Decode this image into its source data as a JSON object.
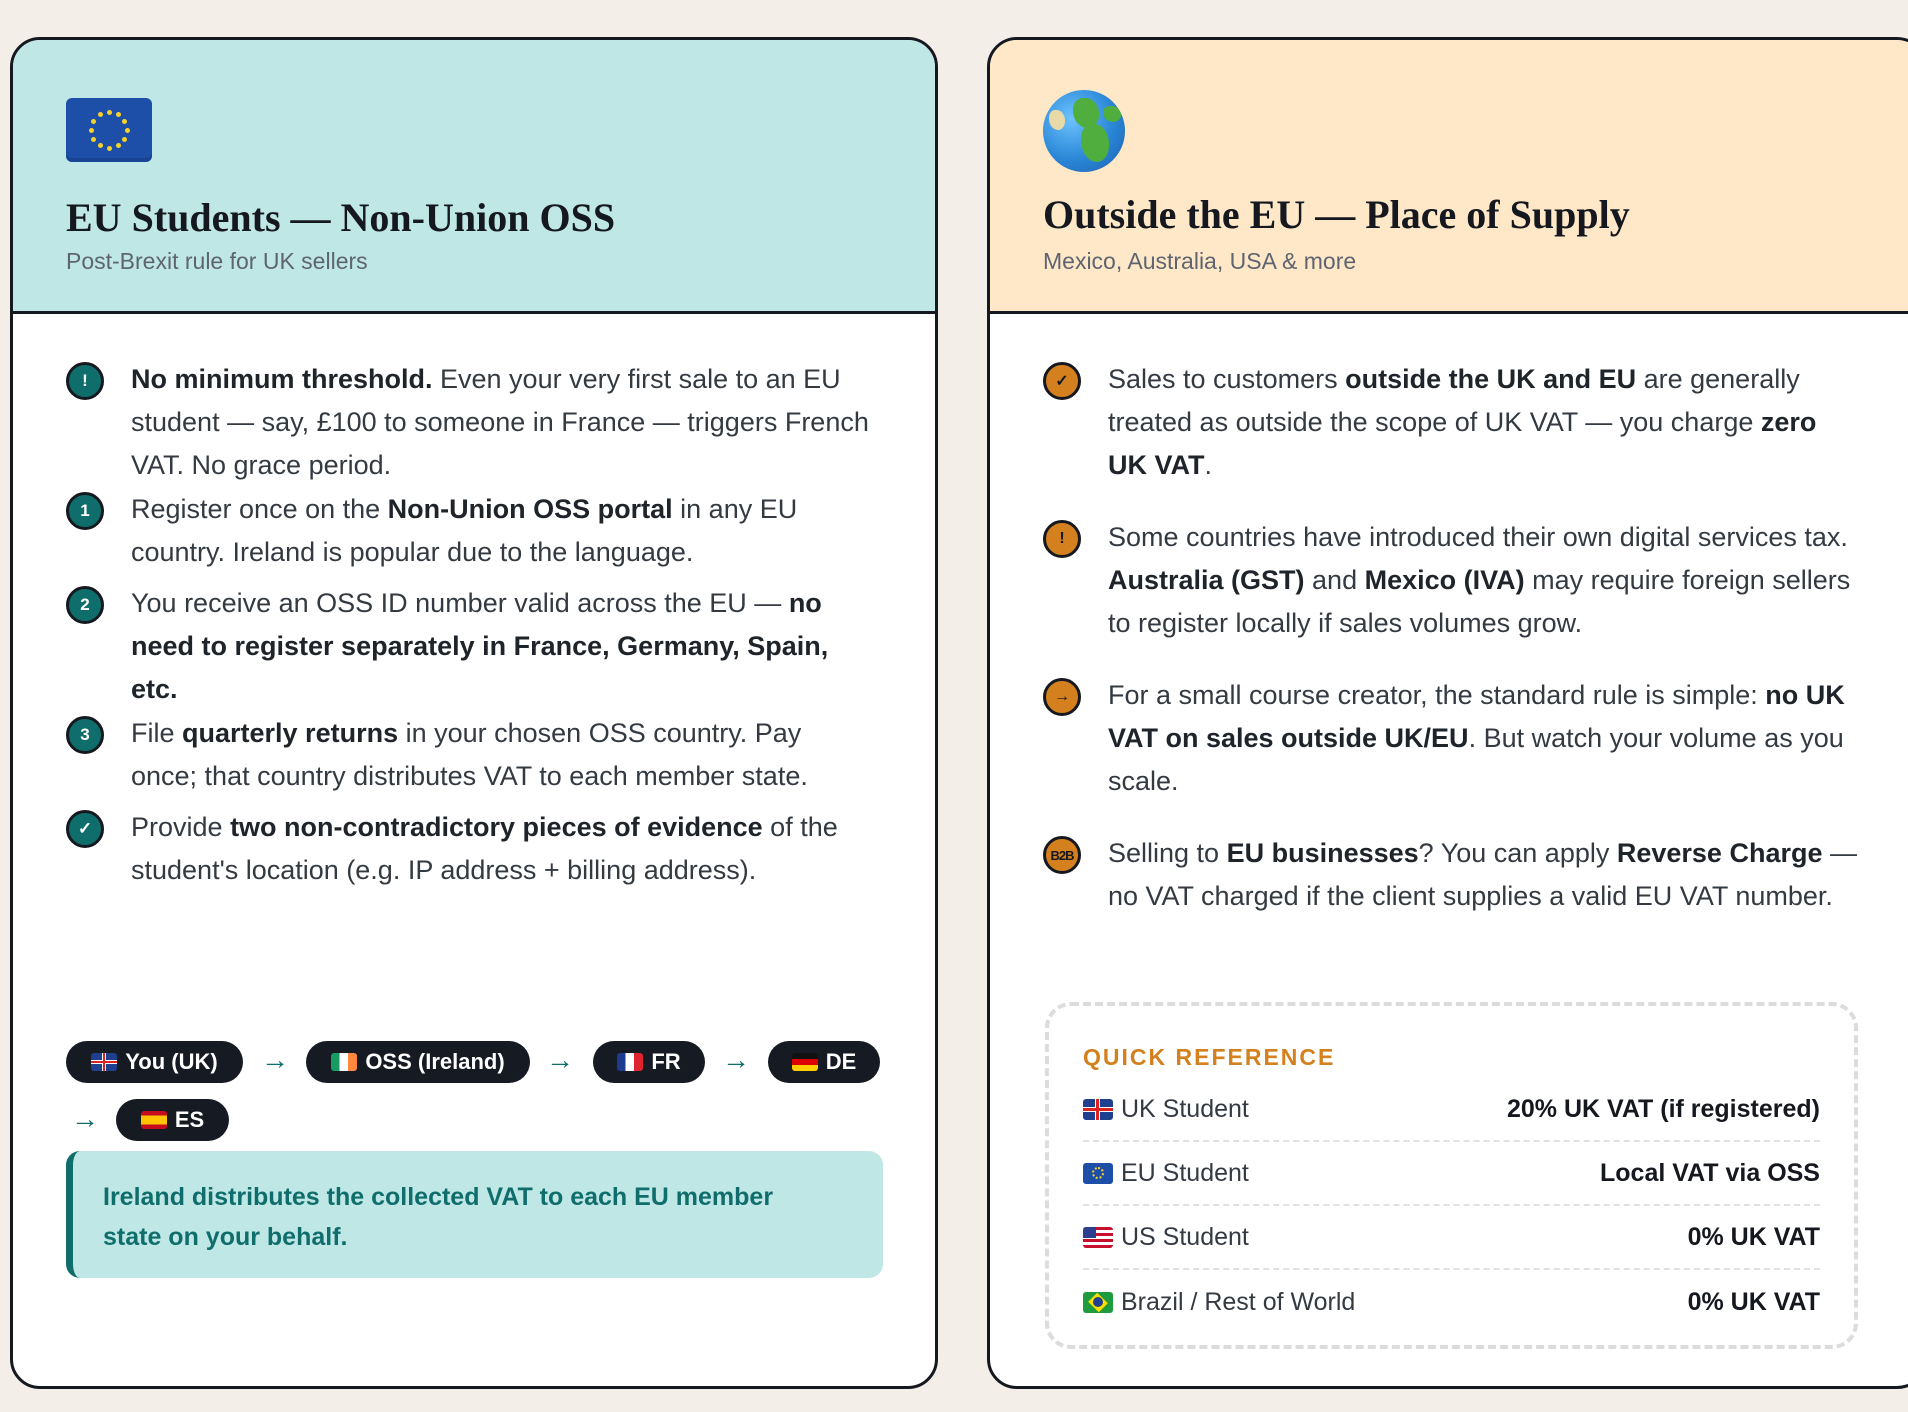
{
  "eu_card": {
    "title": "EU Students — Non-Union OSS",
    "subtitle": "Post-Brexit rule for UK sellers",
    "flag_icon": "eu-flag-icon",
    "header_color": "#bfe7e5",
    "accent_color": "#0f6e6b",
    "items": [
      {
        "badge": "!",
        "parts": [
          {
            "b": "No minimum threshold."
          },
          {
            "t": " Even your very first sale to an EU student — say, £100 to someone in France — triggers French VAT. No grace period."
          }
        ]
      },
      {
        "badge": "1",
        "parts": [
          {
            "t": "Register once on the "
          },
          {
            "b": "Non-Union OSS portal"
          },
          {
            "t": " in any EU country. Ireland is popular due to the language."
          }
        ]
      },
      {
        "badge": "2",
        "parts": [
          {
            "t": "You receive an OSS ID number valid across the EU — "
          },
          {
            "b": "no need to register separately in France, Germany, Spain, etc."
          }
        ]
      },
      {
        "badge": "3",
        "parts": [
          {
            "t": "File "
          },
          {
            "b": "quarterly returns"
          },
          {
            "t": " in your chosen OSS country. Pay once; that country distributes VAT to each member state."
          }
        ]
      },
      {
        "badge": "✓",
        "parts": [
          {
            "t": "Provide "
          },
          {
            "b": "two non-contradictory pieces of evidence"
          },
          {
            "t": " of the student's location (e.g. IP address + billing address)."
          }
        ]
      }
    ],
    "flow": [
      "You (UK)",
      "OSS (Ireland)",
      "FR",
      "DE",
      "ES"
    ],
    "flow_arrow": "→",
    "note": "Ireland distributes the collected VAT to each EU member state on your behalf."
  },
  "world_card": {
    "title": "Outside the EU — Place of Supply",
    "subtitle": "Mexico, Australia, USA & more",
    "flag_icon": "globe-icon",
    "header_color": "#ffe8c8",
    "accent_color": "#d4801e",
    "items": [
      {
        "badge": "✓",
        "parts": [
          {
            "t": "Sales to customers "
          },
          {
            "b": "outside the UK and EU"
          },
          {
            "t": " are generally treated as outside the scope of UK VAT — you charge "
          },
          {
            "b": "zero UK VAT"
          },
          {
            "t": "."
          }
        ]
      },
      {
        "badge": "!",
        "parts": [
          {
            "t": "Some countries have introduced their own digital services tax. "
          },
          {
            "b": "Australia (GST)"
          },
          {
            "t": " and "
          },
          {
            "b": "Mexico (IVA)"
          },
          {
            "t": " may require foreign sellers to register locally if sales volumes grow."
          }
        ]
      },
      {
        "badge": "→",
        "parts": [
          {
            "t": "For a small course creator, the standard rule is simple: "
          },
          {
            "b": "no UK VAT on sales outside UK/EU"
          },
          {
            "t": ". But watch your volume as you scale."
          }
        ]
      },
      {
        "badge": "B2B",
        "parts": [
          {
            "t": "Selling to "
          },
          {
            "b": "EU businesses"
          },
          {
            "t": "? You can apply "
          },
          {
            "b": "Reverse Charge"
          },
          {
            "t": " — no VAT charged if the client supplies a valid EU VAT number."
          }
        ]
      }
    ],
    "quick_reference": {
      "title": "QUICK REFERENCE",
      "rows": [
        {
          "flag": "uk-flag-icon",
          "label": "UK Student",
          "value": "20% UK VAT (if registered)"
        },
        {
          "flag": "eu-flag-icon",
          "label": "EU Student",
          "value": "Local VAT via OSS"
        },
        {
          "flag": "us-flag-icon",
          "label": "US Student",
          "value": "0% UK VAT"
        },
        {
          "flag": "brazil-flag-icon",
          "label": "Brazil / Rest of World",
          "value": "0% UK VAT"
        }
      ]
    }
  }
}
